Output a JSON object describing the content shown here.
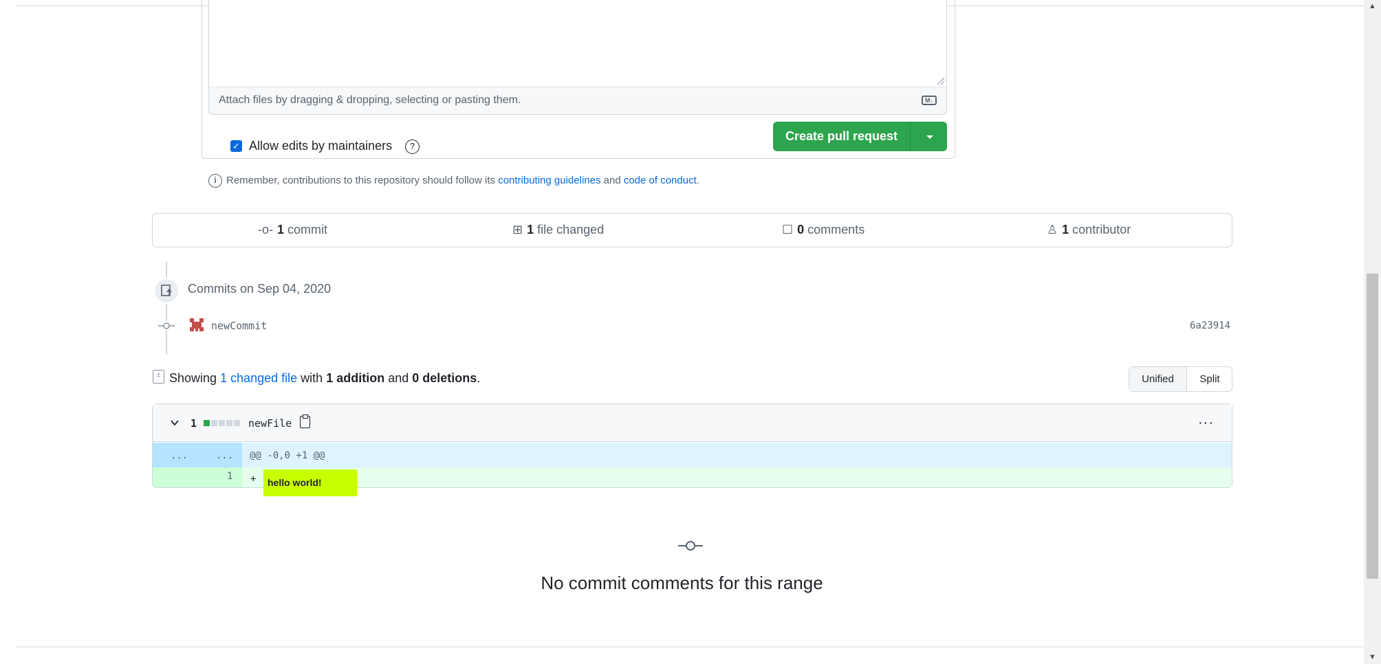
{
  "compose": {
    "attach_text": "Attach files by dragging & dropping, selecting or pasting them.",
    "markdown_icon": "markdown-icon",
    "allow_edits_label": "Allow edits by maintainers",
    "help_icon": "question-icon",
    "create_button": "Create pull request",
    "accent_color": "#2da44e"
  },
  "remember": {
    "prefix": "Remember, contributions to this repository should follow its",
    "guidelines_link": "contributing guidelines",
    "and": "and",
    "conduct_link": "code of conduct",
    "suffix": "."
  },
  "stats": {
    "commits_count": "1",
    "commits_label": "commit",
    "files_count": "1",
    "files_label": "file changed",
    "comments_count": "0",
    "comments_label": "comments",
    "contributors_count": "1",
    "contributors_label": "contributor"
  },
  "commits": {
    "heading": "Commits on Sep 04, 2020",
    "items": [
      {
        "message": "newCommit",
        "sha": "6a23914"
      }
    ]
  },
  "summary": {
    "showing": "Showing",
    "changed_link": "1 changed file",
    "with": "with",
    "additions": "1 addition",
    "and": "and",
    "deletions": "0 deletions",
    "end": "."
  },
  "view_toggle": {
    "unified": "Unified",
    "split": "Split",
    "selected": "Unified"
  },
  "file": {
    "change_count": "1",
    "name": "newFile",
    "hunk_left": "...",
    "hunk_right": "...",
    "hunk_header": "@@ -0,0 +1 @@",
    "line_number": "1",
    "sign": "+",
    "code": "hello world!"
  },
  "empty_comments": {
    "text": "No commit comments for this range"
  }
}
